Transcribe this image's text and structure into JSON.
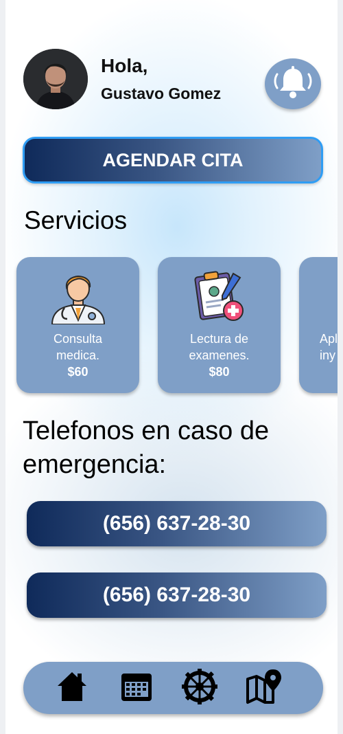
{
  "header": {
    "greeting": "Hola,",
    "user_name": "Gustavo Gomez",
    "avatar_icon": "user-photo",
    "notification_icon": "bell-icon"
  },
  "cta": {
    "label": "AGENDAR CITA"
  },
  "services": {
    "title": "Servicios",
    "items": [
      {
        "icon": "doctor-icon",
        "name_line1": "Consulta",
        "name_line2": "medica.",
        "price": "$60"
      },
      {
        "icon": "clipboard-report-icon",
        "name_line1": "Lectura de",
        "name_line2": "examenes.",
        "price": "$80"
      },
      {
        "icon": "injection-icon",
        "name_line1": "Apli",
        "name_line2": "iny",
        "price": ""
      }
    ]
  },
  "emergency": {
    "title": "Telefonos en caso de emergencia:",
    "phones": [
      "(656) 637-28-30",
      "(656) 637-28-30"
    ]
  },
  "bottom_nav": {
    "items": [
      "home-icon",
      "calendar-icon",
      "settings-gear-icon",
      "map-pin-icon"
    ]
  },
  "colors": {
    "accent_blue": "#7f9fc7",
    "dark_navy": "#0f2a5a",
    "cta_border": "#2f9df4"
  }
}
